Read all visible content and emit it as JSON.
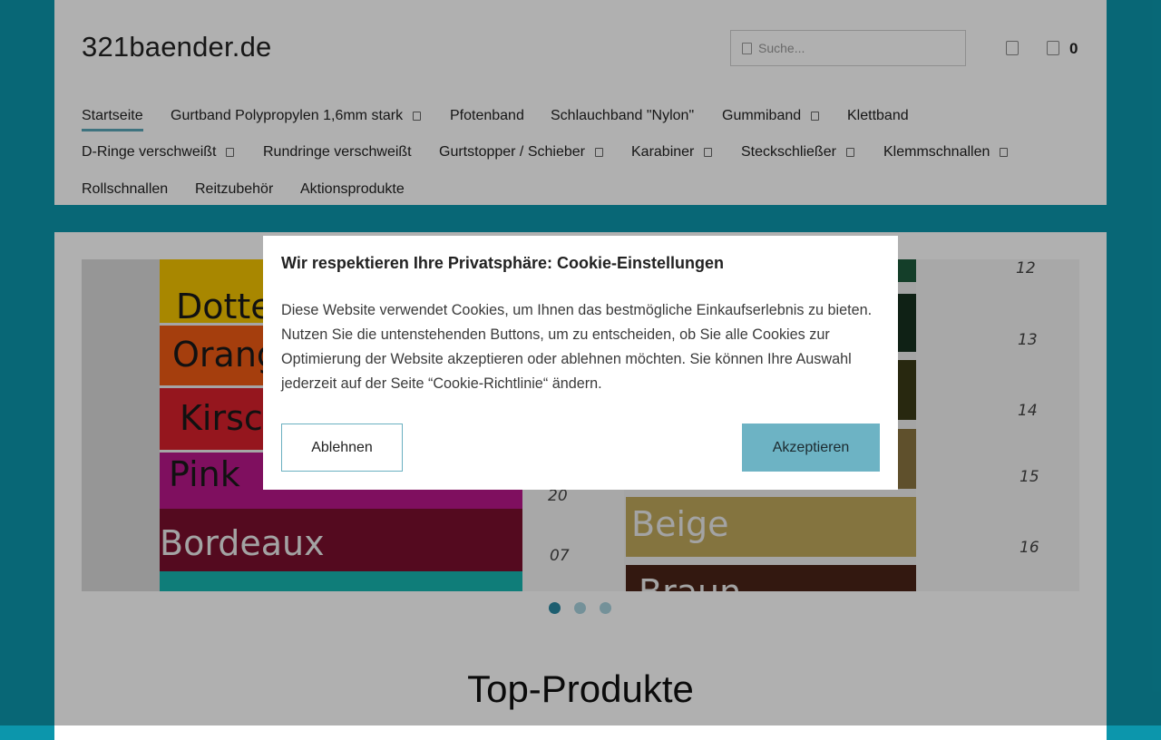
{
  "header": {
    "logo": "321baender.de",
    "search_placeholder": "Suche...",
    "cart_count": "0"
  },
  "nav": {
    "items": [
      {
        "label": "Startseite",
        "active": true,
        "submenu": false
      },
      {
        "label": "Gurtband Polypropylen 1,6mm stark",
        "active": false,
        "submenu": true
      },
      {
        "label": "Pfotenband",
        "active": false,
        "submenu": false
      },
      {
        "label": "Schlauchband \"Nylon\"",
        "active": false,
        "submenu": false
      },
      {
        "label": "Gummiband",
        "active": false,
        "submenu": true
      },
      {
        "label": "Klettband",
        "active": false,
        "submenu": false
      },
      {
        "label": "D-Ringe verschweißt",
        "active": false,
        "submenu": true
      },
      {
        "label": "Rundringe verschweißt",
        "active": false,
        "submenu": false
      },
      {
        "label": "Gurtstopper / Schieber",
        "active": false,
        "submenu": true
      },
      {
        "label": "Karabiner",
        "active": false,
        "submenu": true
      },
      {
        "label": "Steckschließer",
        "active": false,
        "submenu": true
      },
      {
        "label": "Klemmschnallen",
        "active": false,
        "submenu": true
      },
      {
        "label": "Rollschnallen",
        "active": false,
        "submenu": false
      },
      {
        "label": "Reitzubehör",
        "active": false,
        "submenu": false
      },
      {
        "label": "Aktionsprodukte",
        "active": false,
        "submenu": false
      }
    ]
  },
  "slider": {
    "left_labels": [
      "Dotte",
      "Orang",
      "Kirsc",
      "Pink",
      "Bordeaux"
    ],
    "left_numbers": [
      "20",
      "07"
    ],
    "right_labels": [
      "Beige",
      "Braun"
    ],
    "right_numbers": [
      "12",
      "13",
      "14",
      "15",
      "16"
    ],
    "slide_count": 3,
    "active_slide": 1
  },
  "main": {
    "section_title": "Top-Produkte"
  },
  "cookie_dialog": {
    "title": "Wir respektieren Ihre Privatsphäre: Cookie-Einstellungen",
    "text": "Diese Website verwendet Cookies, um Ihnen das bestmögliche Einkaufserlebnis zu bieten. Nutzen Sie die untenstehenden Buttons, um zu entscheiden, ob Sie alle Cookies zur Optimierung der Website akzeptieren oder ablehnen möchten. Sie können Ihre Auswahl jederzeit auf der Seite “Cookie-Richtlinie“ ändern.",
    "decline_label": "Ablehnen",
    "accept_label": "Akzeptieren"
  },
  "colors": {
    "page_background": "#0c96ac",
    "accent": "#6db3c4",
    "active_dot": "#2b88a3"
  },
  "icons": {
    "search": "search-icon",
    "account": "user-icon",
    "cart": "cart-icon",
    "submenu": "chevron-down-icon"
  }
}
